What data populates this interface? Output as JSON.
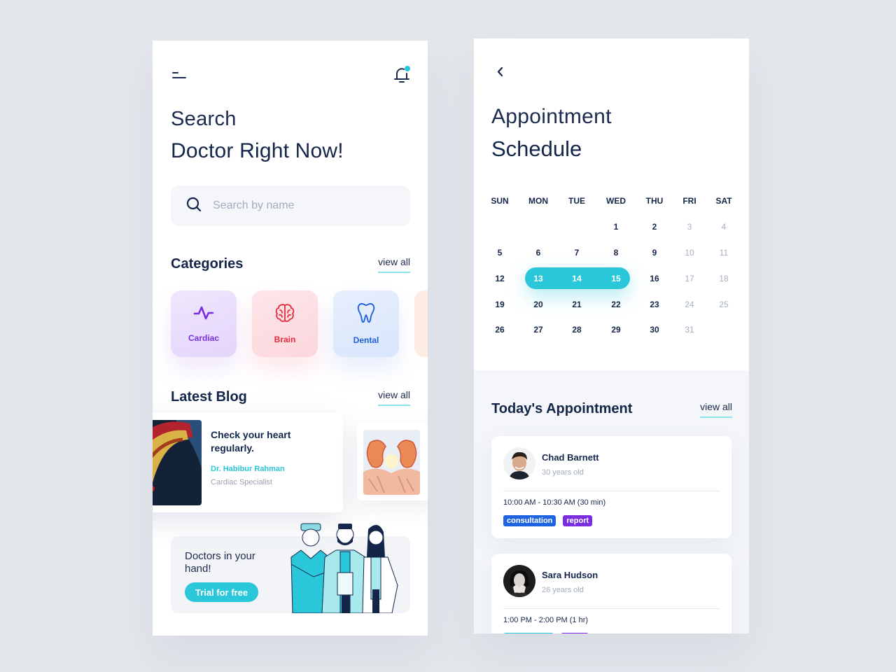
{
  "colors": {
    "background": "#e4e7ec",
    "accent": "#2ac6d9",
    "text_dark": "#13264a",
    "cardiac": "#7b2ee0",
    "brain": "#e52a3b",
    "dental": "#2160d8",
    "tag_consultation": "#1e63e0",
    "tag_report": "#7b2ee0"
  },
  "home": {
    "menu_icon": "menu-icon",
    "notification_icon": "bell-icon",
    "has_notification": true,
    "title_line1": "Search",
    "title_line2": "Doctor Right Now!",
    "search": {
      "placeholder": "Search by name",
      "value": "",
      "icon": "search-icon"
    },
    "categories": {
      "title": "Categories",
      "view_all": "view all",
      "items": [
        {
          "label": "Cardiac",
          "icon": "heartbeat-icon"
        },
        {
          "label": "Brain",
          "icon": "brain-icon"
        },
        {
          "label": "Dental",
          "icon": "tooth-icon"
        },
        {
          "label": "",
          "icon": ""
        }
      ]
    },
    "blog": {
      "title": "Latest Blog",
      "view_all": "view all",
      "posts": [
        {
          "title": "Check your heart regularly.",
          "author": "Dr. Habibur Rahman",
          "role": "Cardiac Specialist",
          "image": "artery-illustration"
        },
        {
          "title": "",
          "author": "",
          "role": "",
          "image": "kidney-illustration"
        }
      ]
    },
    "promo": {
      "text": "Doctors in your hand!",
      "button": "Trial for free",
      "illustration": "doctors-illustration"
    }
  },
  "schedule": {
    "back_icon": "chevron-left-icon",
    "title_line1": "Appointment",
    "title_line2": "Schedule",
    "calendar": {
      "weekdays": [
        "SUN",
        "MON",
        "TUE",
        "WED",
        "THU",
        "FRI",
        "SAT"
      ],
      "weeks": [
        [
          "",
          "",
          "",
          "1",
          "2",
          "3",
          "4"
        ],
        [
          "5",
          "6",
          "7",
          "8",
          "9",
          "10",
          "11"
        ],
        [
          "12",
          "13",
          "14",
          "15",
          "16",
          "17",
          "18"
        ],
        [
          "19",
          "20",
          "21",
          "22",
          "23",
          "24",
          "25"
        ],
        [
          "26",
          "27",
          "28",
          "29",
          "30",
          "31",
          ""
        ]
      ],
      "selected_range": [
        "13",
        "15"
      ],
      "muted_columns": [
        "FRI",
        "SAT"
      ]
    },
    "today": {
      "title": "Today's Appointment",
      "view_all": "view all",
      "appointments": [
        {
          "name": "Chad Barnett",
          "age": "30 years old",
          "time": "10:00 AM - 10:30 AM (30 min)",
          "tags": [
            {
              "label": "consultation",
              "color": "#1e63e0"
            },
            {
              "label": "report",
              "color": "#7b2ee0"
            }
          ]
        },
        {
          "name": "Sara Hudson",
          "age": "26 years old",
          "time": "1:00 PM - 2:00 PM (1 hr)",
          "tags": [
            {
              "label": "",
              "color": "#2ac6d9"
            },
            {
              "label": "",
              "color": "#7b2ee0"
            }
          ]
        }
      ]
    }
  }
}
